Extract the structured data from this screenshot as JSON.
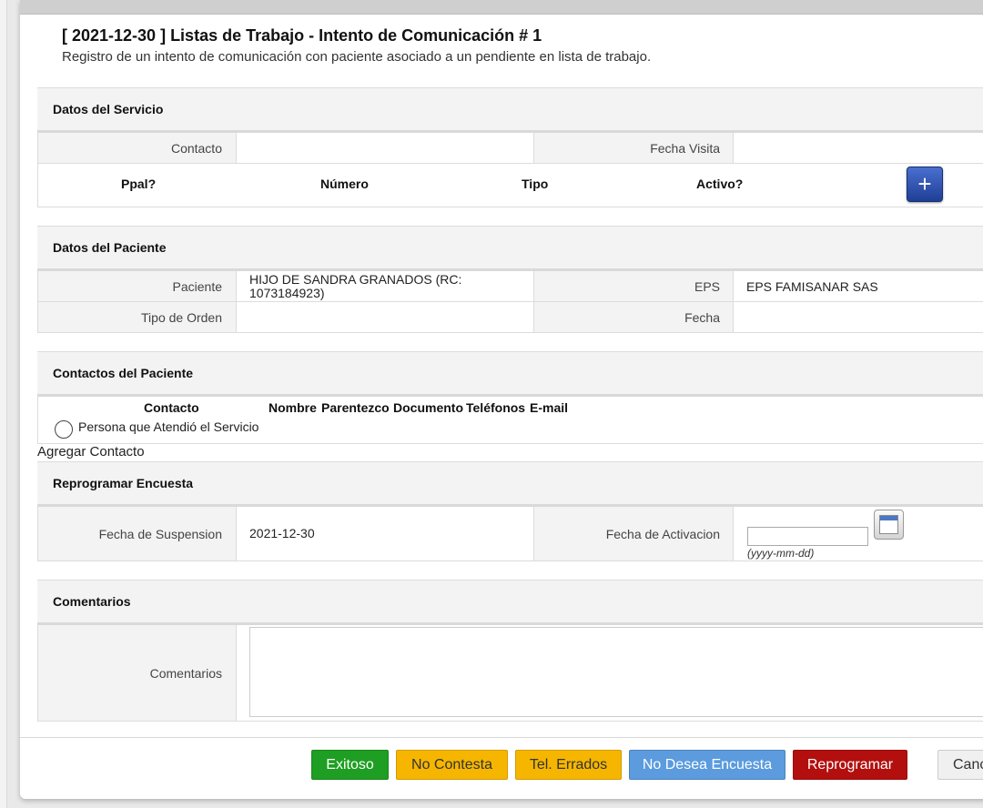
{
  "header": {
    "title": "[ 2021-12-30 ] Listas de Trabajo - Intento de Comunicación # 1",
    "subtitle": "Registro de un intento de comunicación con paciente asociado a un pendiente en lista de trabajo."
  },
  "servicio": {
    "section_title": "Datos del Servicio",
    "contacto_label": "Contacto",
    "contacto_value": "",
    "fecha_visita_label": "Fecha Visita",
    "fecha_visita_value": "",
    "columns": [
      "Ppal?",
      "Número",
      "Tipo",
      "Activo?"
    ],
    "add_icon": "plus-icon"
  },
  "paciente": {
    "section_title": "Datos del Paciente",
    "paciente_label": "Paciente",
    "paciente_value": "HIJO DE SANDRA GRANADOS (RC: 1073184923)",
    "eps_label": "EPS",
    "eps_value": "EPS FAMISANAR SAS",
    "tipo_orden_label": "Tipo de Orden",
    "tipo_orden_value": "",
    "fecha_label": "Fecha",
    "fecha_value": ""
  },
  "contactos": {
    "section_title": "Contactos del Paciente",
    "columns": [
      "Contacto",
      "Nombre",
      "Parentezco",
      "Documento",
      "Teléfonos",
      "E-mail"
    ],
    "radio_label": "Persona que Atendió el Servicio",
    "add_contact": "Agregar Contacto"
  },
  "reprogramar": {
    "section_title": "Reprogramar Encuesta",
    "suspension_label": "Fecha de Suspension",
    "suspension_value": "2021-12-30",
    "activacion_label": "Fecha de Activacion",
    "activacion_value": "",
    "date_hint": "(yyyy-mm-dd)",
    "calendar_icon": "calendar-icon"
  },
  "comentarios": {
    "section_title": "Comentarios",
    "label": "Comentarios",
    "value": ""
  },
  "actions": {
    "exitoso": "Exitoso",
    "no_contesta": "No Contesta",
    "tel_errados": "Tel. Errados",
    "no_desea": "No Desea Encuesta",
    "reprogramar": "Reprogramar",
    "cancelar": "Canc"
  },
  "colors": {
    "exitoso": "#1e9e22",
    "warning": "#f6b600",
    "info": "#5b9bde",
    "danger": "#b30f0f"
  }
}
